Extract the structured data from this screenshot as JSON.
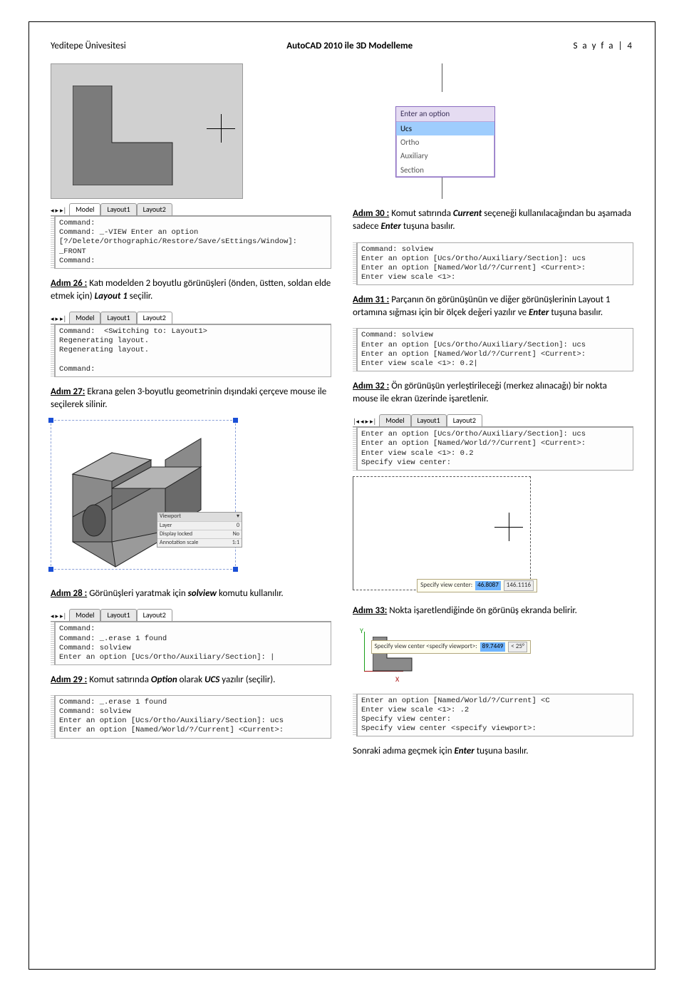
{
  "header": {
    "left": "Yeditepe Ünivesitesi",
    "center": "AutoCAD 2010 ile 3D Modelleme",
    "right": "S a y f a  | 4"
  },
  "left_col": {
    "tabbar1": {
      "model": "Model",
      "l1": "Layout1",
      "l2": "Layout2"
    },
    "cmd1": "Command:\nCommand: _-VIEW Enter an option\n[?/Delete/Orthographic/Restore/Save/sEttings/Window]: _FRONT\nCommand:",
    "step26": {
      "label": "Adım 26 :",
      "text_a": " Katı modelden 2 boyutlu görünüşleri (önden, üstten, soldan elde etmek için) ",
      "ital": "Layout 1",
      "text_b": " seçilir."
    },
    "cmd2": "Command:  <Switching to: Layout1>\nRegenerating layout.\nRegenerating layout.\n\nCommand:",
    "step27": {
      "label": "Adım 27:",
      "text": " Ekrana gelen 3-boyutlu geometrinin dışındaki çerçeve mouse ile seçilerek silinir."
    },
    "propbox": {
      "r1": "Viewport",
      "r2a": "Layer",
      "r2b": "0",
      "r3a": "Display locked",
      "r3b": "No",
      "r4a": "Annotation scale",
      "r4b": "1:1"
    },
    "step28": {
      "label": "Adım 28 :",
      "text_a": " Görünüşleri yaratmak için ",
      "ital": "solview",
      "text_b": " komutu kullanılır."
    },
    "cmd3": "Command:\nCommand: _.erase 1 found\nCommand: solview\nEnter an option [Ucs/Ortho/Auxiliary/Section]: |",
    "step29": {
      "label": "Adım 29 :",
      "text_a": " Komut satırında ",
      "ital1": "Option",
      "mid": " olarak ",
      "ital2": "UCS",
      "text_b": " yazılır (seçilir)."
    },
    "cmd4": "Command: _.erase 1 found\nCommand: solview\nEnter an option [Ucs/Ortho/Auxiliary/Section]: ucs\nEnter an option [Named/World/?/Current] <Current>:"
  },
  "right_col": {
    "menu": {
      "hdr": "Enter an option",
      "o1": "Ucs",
      "o2": "Ortho",
      "o3": "Auxiliary",
      "o4": "Section"
    },
    "step30": {
      "label": "Adım 30 :",
      "text_a": " Komut satırında ",
      "ital1": "Current",
      "mid": " seçeneği kullanılacağından bu aşamada sadece ",
      "ital2": "Enter",
      "text_b": " tuşuna basılır."
    },
    "cmd5": "Command: solview\nEnter an option [Ucs/Ortho/Auxiliary/Section]: ucs\nEnter an option [Named/World/?/Current] <Current>:\nEnter view scale <1>:",
    "step31": {
      "label": "Adım 31 :",
      "text_a": " Parçanın ön görünüşünün ve diğer görünüşlerinin Layout 1 ortamına sığması için bir ölçek değeri yazılır ve ",
      "ital": "Enter",
      "text_b": " tuşuna basılır."
    },
    "cmd6": "Command: solview\nEnter an option [Ucs/Ortho/Auxiliary/Section]: ucs\nEnter an option [Named/World/?/Current] <Current>:\nEnter view scale <1>: 0.2|",
    "step32": {
      "label": "Adım 32 :",
      "text": " Ön görünüşün yerleştirileceği (merkez alınacağı) bir nokta mouse ile ekran üzerinde işaretlenir."
    },
    "cmd7": "Enter an option [Ucs/Ortho/Auxiliary/Section]: ucs\nEnter an option [Named/World/?/Current] <Current>:\nEnter view scale <1>: 0.2\nSpecify view center:",
    "tooltip_center": {
      "label": "Specify view center:",
      "v1": "46.8087",
      "v2": "146.1116"
    },
    "step33": {
      "label": "Adım 33:",
      "text": " Nokta işaretlendiğinde ön görünüş ekranda belirir."
    },
    "tooltip_vp": {
      "label": "Specify view center <specify viewport>:",
      "v1": "89.7449",
      "v2": "< 25°"
    },
    "axes": {
      "y": "Y",
      "x": "X"
    },
    "cmd8": "Enter an option [Named/World/?/Current] <C\nEnter view scale <1>: .2\nSpecify view center:\nSpecify view center <specify viewport>:",
    "footer_step": {
      "text_a": "Sonraki adıma geçmek için ",
      "ital": "Enter",
      "text_b": " tuşuna basılır."
    }
  }
}
